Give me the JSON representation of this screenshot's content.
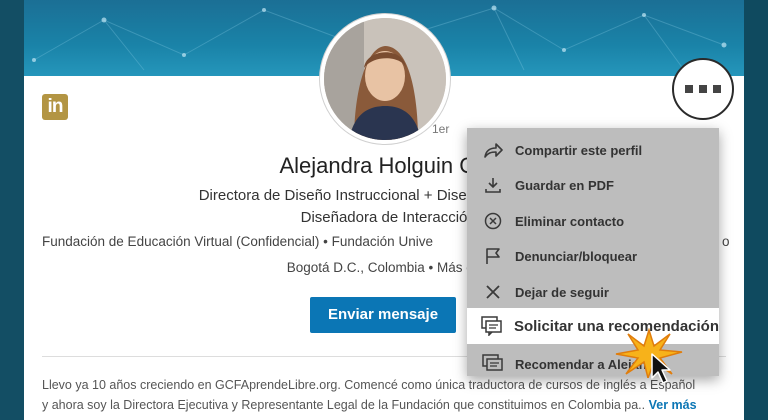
{
  "profile": {
    "name": "Alejandra Holguin Gir",
    "degree": "1er",
    "headline_line1": "Directora de Diseño Instruccional + Diseñadora de LMS",
    "headline_line2": "Diseñadora de Interacció",
    "companies": "Fundación de Educación Virtual (Confidencial) • Fundación Unive",
    "companies_tail": "o",
    "location": "Bogotá D.C., Colombia • Más de",
    "send_message": "Enviar mensaje",
    "summary_line1": "Llevo ya 10 años creciendo en GCFAprendeLibre.org. Comencé como única traductora de cursos de inglés a Español",
    "summary_line2": "y ahora soy la Directora Ejecutiva y Representante Legal de la Fundación que constituimos en Colombia pa..",
    "see_more": "Ver más"
  },
  "menu": {
    "items": [
      {
        "label": "Compartir este perfil",
        "icon": "share-arrow-icon"
      },
      {
        "label": "Guardar en PDF",
        "icon": "download-icon"
      },
      {
        "label": "Eliminar contacto",
        "icon": "remove-circle-icon"
      },
      {
        "label": "Denunciar/bloquear",
        "icon": "flag-icon"
      },
      {
        "label": "Dejar de seguir",
        "icon": "x-icon"
      },
      {
        "label": "Solicitar una recomendación",
        "icon": "comment-stack-icon"
      },
      {
        "label": "Recomendar a Alejan",
        "icon": "comment-stack-icon"
      }
    ],
    "highlighted_index": 5
  },
  "colors": {
    "brand_blue": "#0b76b5",
    "logo_gold": "#b39543",
    "menu_bg": "#bdbdbd",
    "page_bg": "#0f4d63"
  }
}
